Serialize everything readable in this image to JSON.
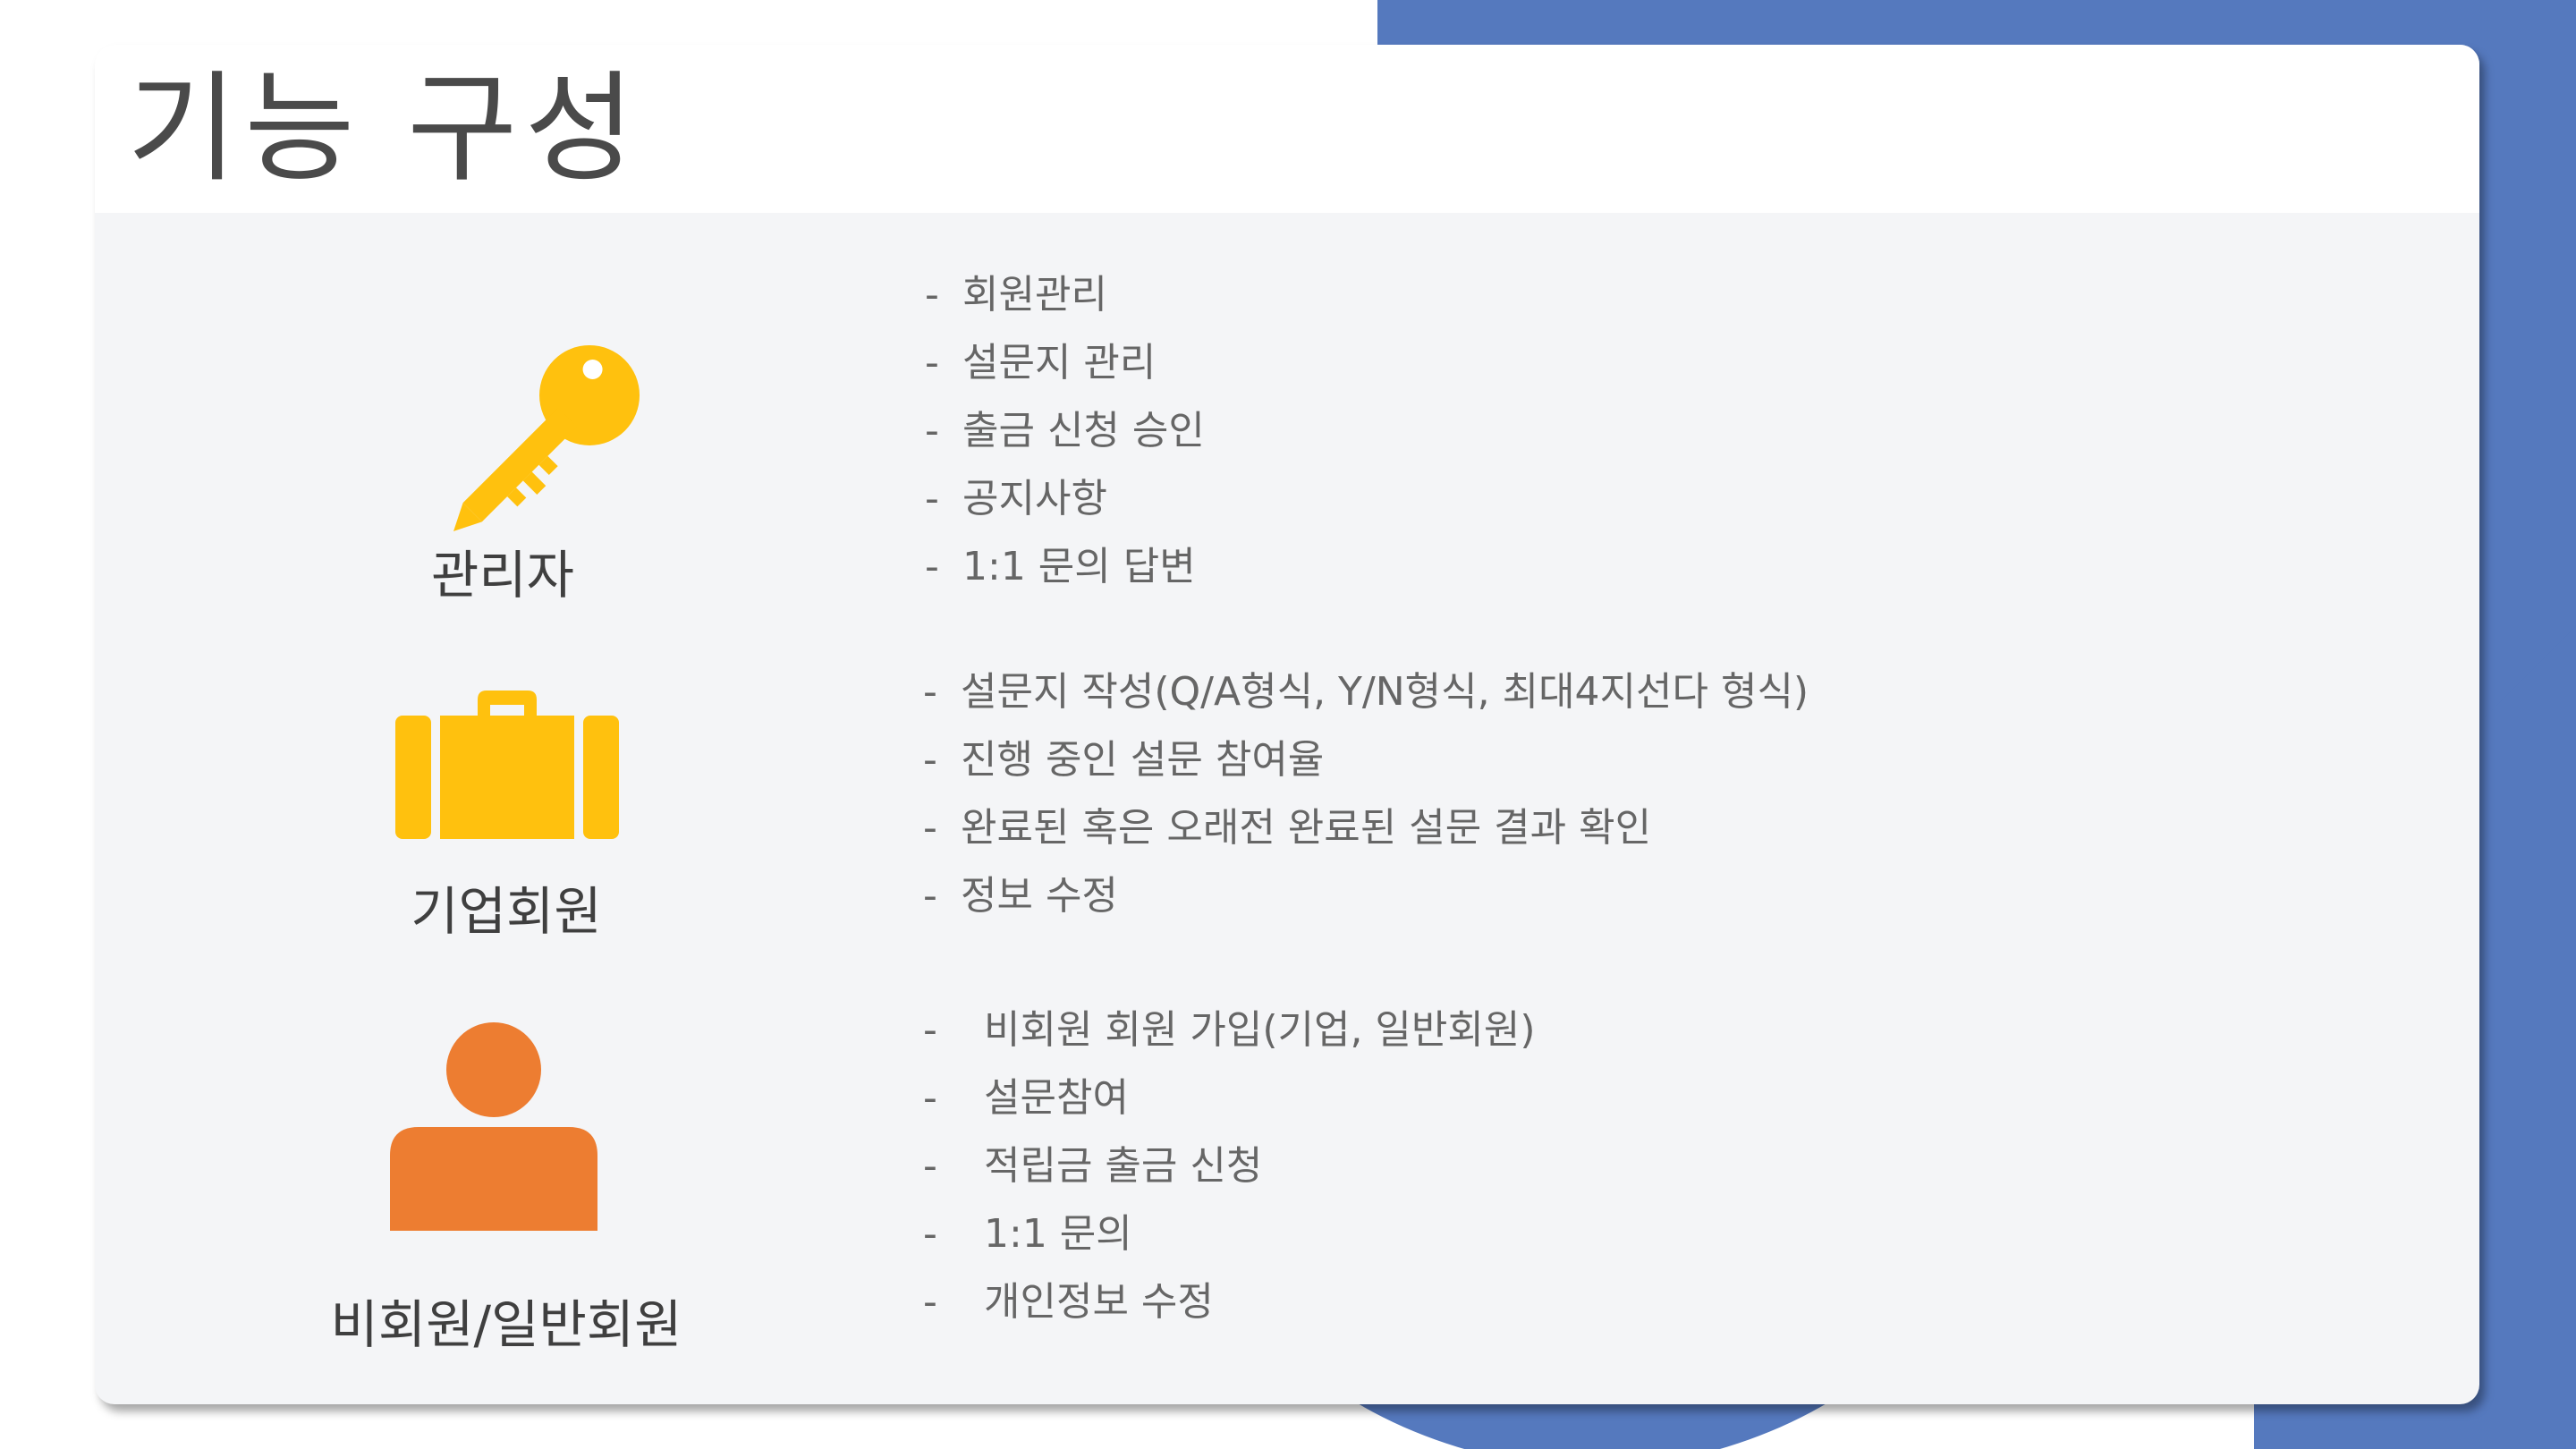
{
  "slide": {
    "title": "기능 구성",
    "accent_color": "#5579be"
  },
  "roles": [
    {
      "label": "관리자",
      "icon": "key-icon",
      "icon_color": "#ffc10e",
      "features": [
        "회원관리",
        "설문지 관리",
        "출금 신청 승인",
        "공지사항",
        "1:1 문의 답변"
      ]
    },
    {
      "label": "기업회원",
      "icon": "briefcase-icon",
      "icon_color": "#ffc10e",
      "features": [
        "설문지 작성(Q/A형식, Y/N형식, 최대4지선다 형식)",
        "진행 중인 설문 참여율",
        "완료된 혹은 오래전 완료된 설문 결과 확인",
        "정보 수정"
      ]
    },
    {
      "label": "비회원/일반회원",
      "icon": "user-icon",
      "icon_color": "#ed7d31",
      "features": [
        "비회원 회원 가입(기업, 일반회원)",
        "설문참여",
        "적립금 출금 신청",
        "1:1 문의",
        "개인정보 수정"
      ]
    }
  ],
  "bullet": "-"
}
